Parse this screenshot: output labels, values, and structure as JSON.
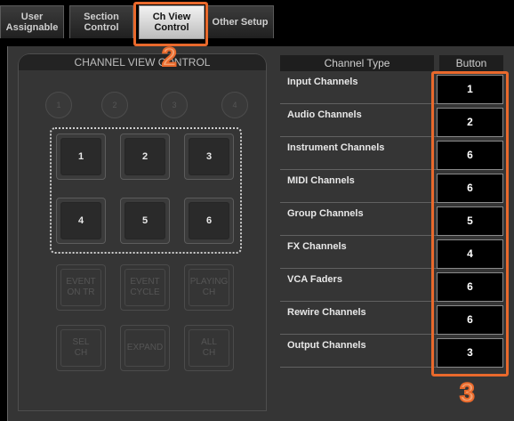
{
  "tabs": [
    {
      "label": "User\nAssignable",
      "active": false
    },
    {
      "label": "Section\nControl",
      "active": false
    },
    {
      "label": "Ch View\nControl",
      "active": true
    },
    {
      "label": "Other Setup",
      "active": false
    }
  ],
  "callouts": {
    "tab": "2",
    "table": "3"
  },
  "section": {
    "title": "CHANNEL VIEW CONTROL",
    "circles": [
      "1",
      "2",
      "3",
      "4"
    ],
    "buttons": [
      "1",
      "2",
      "3",
      "4",
      "5",
      "6"
    ],
    "function_buttons": [
      {
        "label": "EVENT\nON TR"
      },
      {
        "label": "EVENT\nCYCLE"
      },
      {
        "label": "PLAYING\nCH"
      },
      {
        "label": "SEL\nCH"
      },
      {
        "label": "EXPAND"
      },
      {
        "label": "ALL\nCH"
      }
    ]
  },
  "table": {
    "headers": {
      "type": "Channel Type",
      "button": "Button"
    },
    "rows": [
      {
        "type": "Input Channels",
        "button": "1"
      },
      {
        "type": "Audio Channels",
        "button": "2"
      },
      {
        "type": "Instrument Channels",
        "button": "6"
      },
      {
        "type": "MIDI Channels",
        "button": "6"
      },
      {
        "type": "Group Channels",
        "button": "5"
      },
      {
        "type": "FX Channels",
        "button": "4"
      },
      {
        "type": "VCA Faders",
        "button": "6"
      },
      {
        "type": "Rewire Channels",
        "button": "6"
      },
      {
        "type": "Output Channels",
        "button": "3"
      }
    ]
  },
  "colors": {
    "accent": "#e9692c",
    "panel": "#353535"
  }
}
